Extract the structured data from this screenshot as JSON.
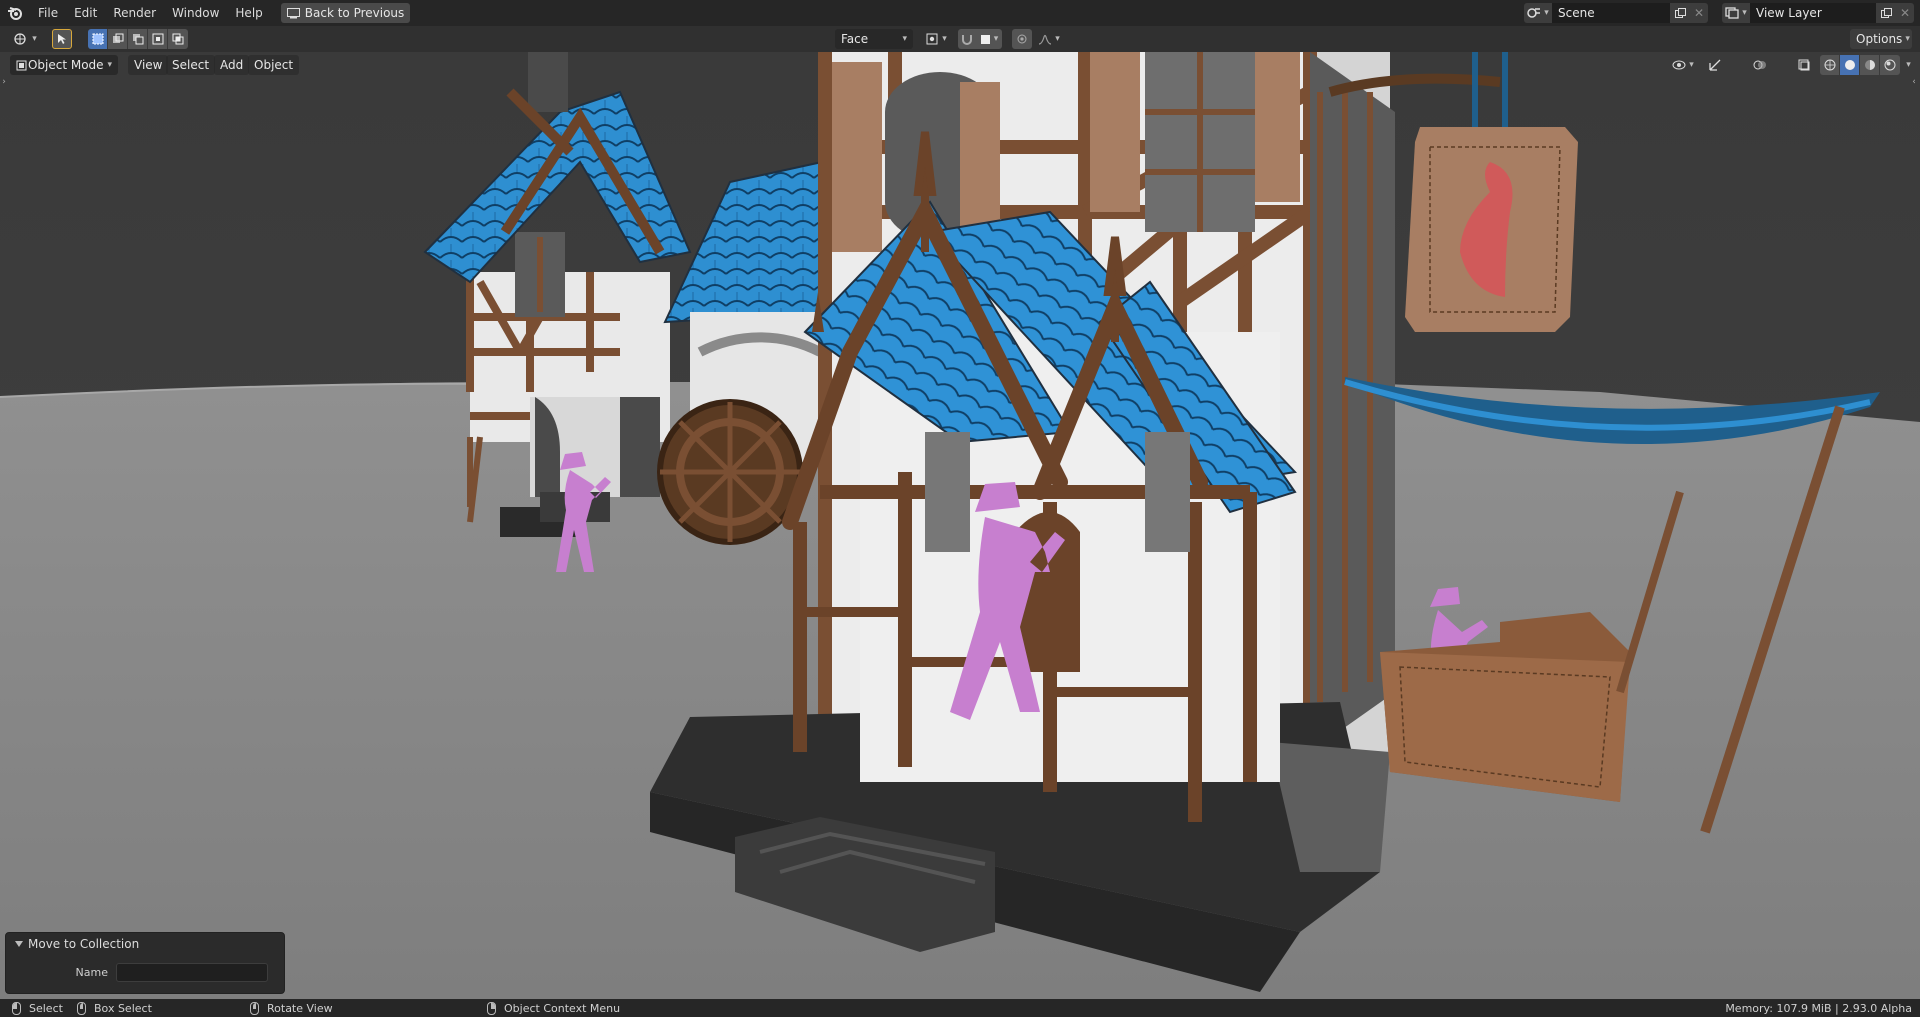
{
  "menu": {
    "items": [
      "File",
      "Edit",
      "Render",
      "Window",
      "Help"
    ],
    "back_button": "Back to Previous"
  },
  "scene": {
    "name": "Scene"
  },
  "view_layer": {
    "name": "View Layer"
  },
  "header": {
    "select_mode": "Face",
    "options_label": "Options"
  },
  "viewport_header": {
    "mode": "Object Mode",
    "menus": [
      "View",
      "Select",
      "Add",
      "Object"
    ]
  },
  "operator_panel": {
    "title": "Move to Collection",
    "name_label": "Name",
    "name_value": ""
  },
  "status": {
    "select": "Select",
    "box_select": "Box Select",
    "rotate_view": "Rotate View",
    "context_menu": "Object Context Menu",
    "memory": "Memory: 107.9 MiB | 2.93.0 Alpha"
  },
  "colors": {
    "accent": "#4772b3",
    "roof_blue": "#2e8fd1",
    "wood": "#7a4f33",
    "figure_pink": "#c77fcf",
    "ground": "#8c8c8c"
  }
}
